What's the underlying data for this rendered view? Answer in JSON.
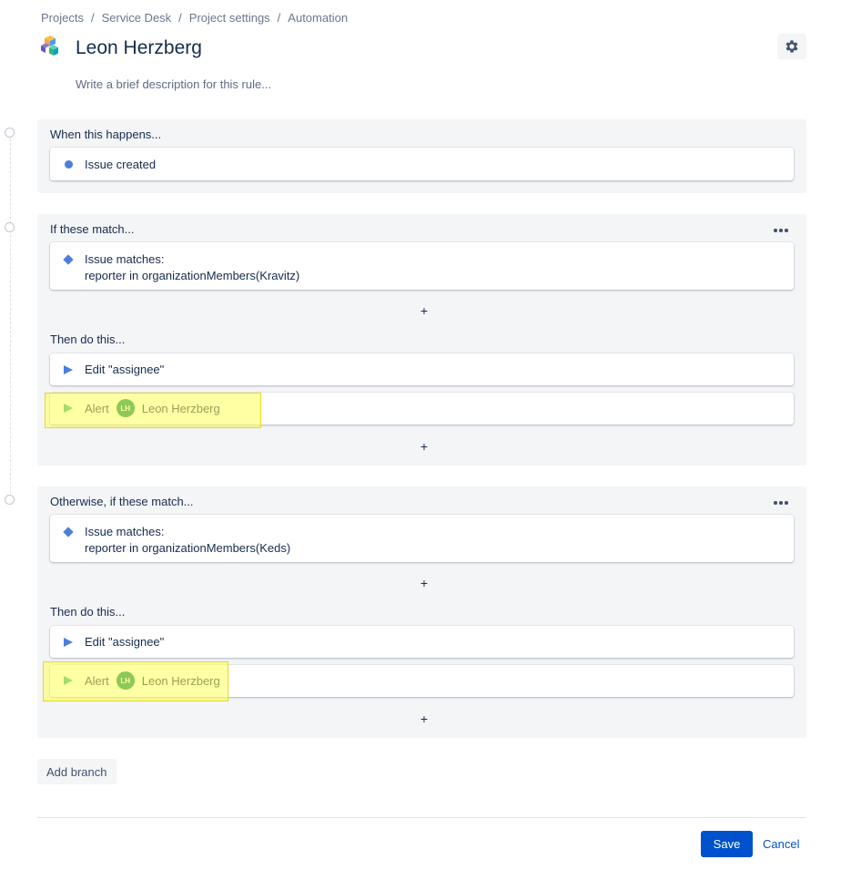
{
  "breadcrumb": [
    "Projects",
    "Service Desk",
    "Project settings",
    "Automation"
  ],
  "rule": {
    "title": "Leon Herzberg",
    "description_placeholder": "Write a brief description for this rule..."
  },
  "trigger": {
    "title": "When this happens...",
    "item": "Issue created"
  },
  "branch1": {
    "title": "If these match...",
    "condition_line1": "Issue matches:",
    "condition_line2": "reporter in organizationMembers(Kravitz)",
    "then_title": "Then do this...",
    "action1": "Edit \"assignee\"",
    "action2_label": "Alert",
    "action2_avatar": "LH",
    "action2_user": "Leon Herzberg"
  },
  "branch2": {
    "title": "Otherwise, if these match...",
    "condition_line1": "Issue matches:",
    "condition_line2": "reporter in organizationMembers(Keds)",
    "then_title": "Then do this...",
    "action1": "Edit \"assignee\"",
    "action2_label": "Alert",
    "action2_avatar": "LH",
    "action2_user": "Leon Herzberg"
  },
  "plus_symbol": "+",
  "buttons": {
    "add_branch": "Add branch",
    "save": "Save",
    "cancel": "Cancel"
  },
  "colors": {
    "primary": "#0052cc",
    "condition_icon": "#4a7ede",
    "action_icon_green": "#36b37e",
    "avatar": "#00875a",
    "highlight": "#ffff5a"
  },
  "icons": {
    "settings": "gear-icon",
    "more": "more-horizontal-icon",
    "trigger": "trigger-dot-icon",
    "condition": "diamond-icon",
    "action": "play-icon"
  }
}
